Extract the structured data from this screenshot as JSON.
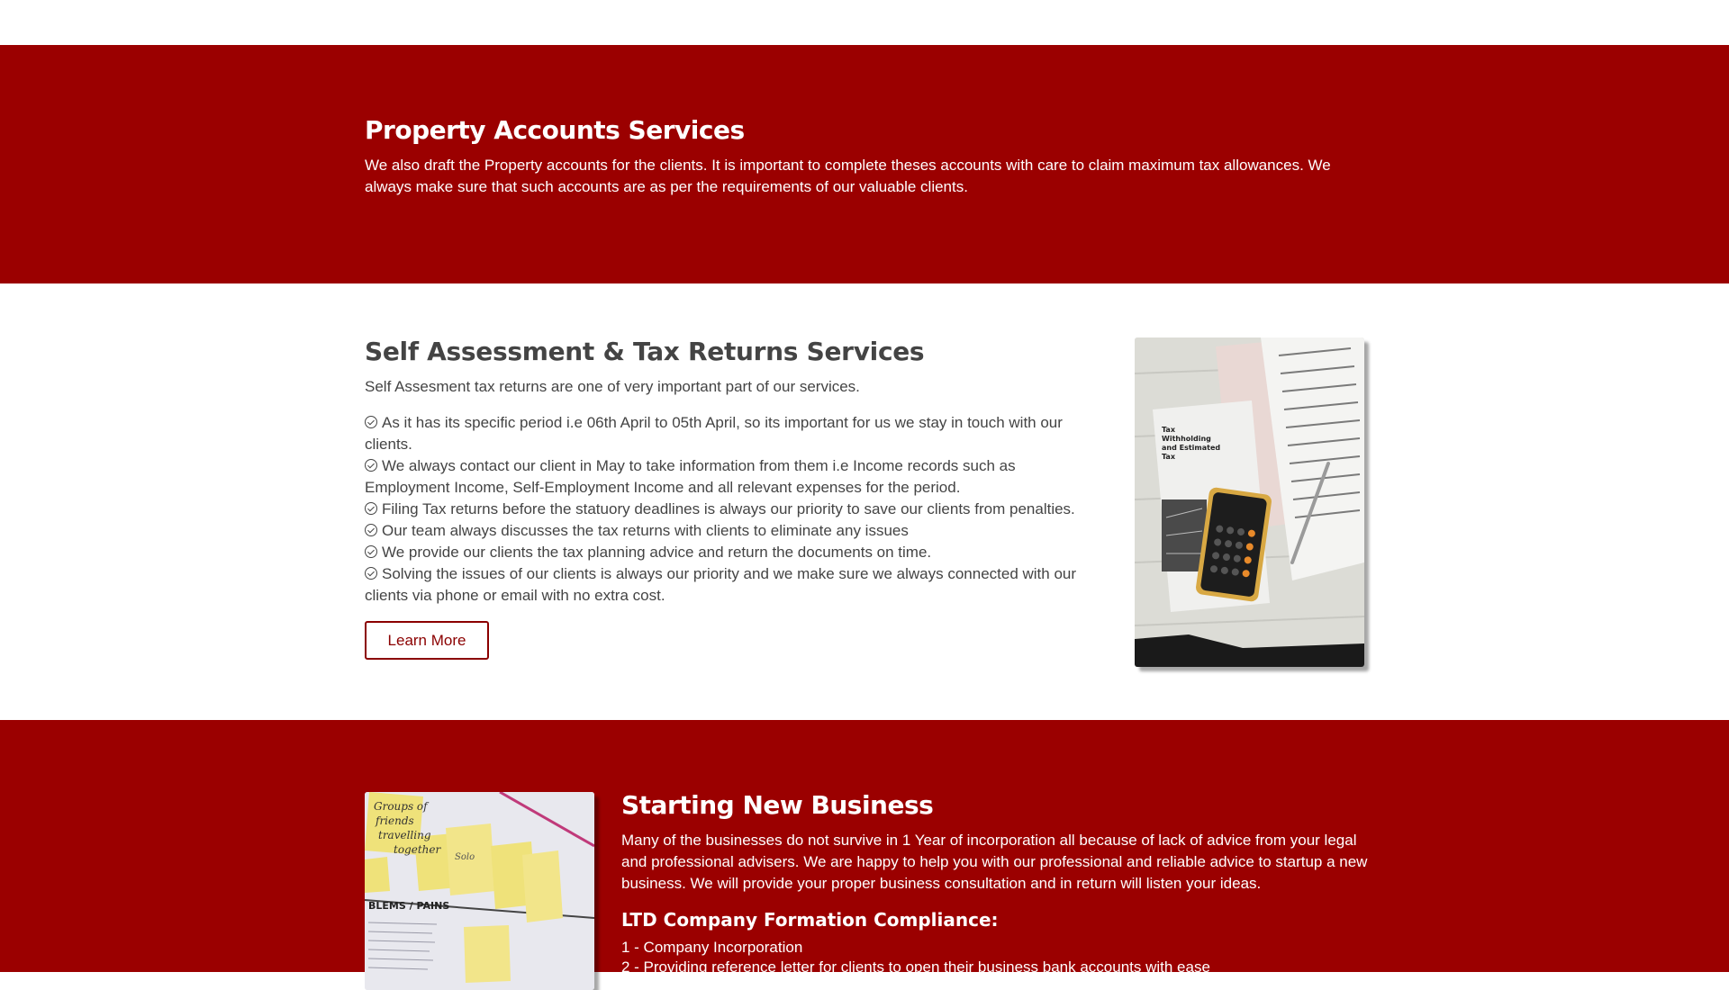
{
  "property_section": {
    "title": "Property Accounts Services",
    "text": "We also draft the Property accounts for the clients. It is important to complete theses accounts with care to claim maximum tax allowances. We always make sure that such accounts are as per the requirements of our valuable clients."
  },
  "self_assessment": {
    "title": "Self Assessment & Tax Returns Services",
    "intro": "Self Assesment tax returns are one of very important part of our services.",
    "items": [
      "As it has its specific period i.e 06th April to 05th April, so its important for us we stay in touch with our clients.",
      "We always contact our client in May to take information from them i.e Income records such as Employment Income, Self-Employment Income and all relevant expenses for the period.",
      "Filing Tax returns before the statuory deadlines is always our priority to save our clients from penalties.",
      "Our team always discusses the tax returns with clients to eliminate any issues",
      "We provide our clients the tax planning advice and return the documents on time.",
      "Solving the issues of our clients is always our priority and we make sure we always connected with our clients via phone or email with no extra cost."
    ],
    "button_label": "Learn More",
    "image_icon": "tax-documents-calculator-photo"
  },
  "starting_business": {
    "title": "Starting New Business",
    "text": "Many of the businesses do not survive in 1 Year of incorporation all because of lack of advice from your legal and professional advisers. We are happy to help you with our professional and reliable advice to startup a new business. We will provide your proper business consultation and in return will listen your ideas.",
    "image_icon": "sticky-notes-board-photo",
    "ltd_title": "LTD Company Formation Compliance:",
    "ltd_items": [
      "1 - Company Incorporation",
      "2 - Providing reference letter for clients to open their business bank accounts with ease"
    ]
  },
  "colors": {
    "brand_red": "#9b0000",
    "button_border": "#8b0000",
    "body_text": "#444444"
  }
}
